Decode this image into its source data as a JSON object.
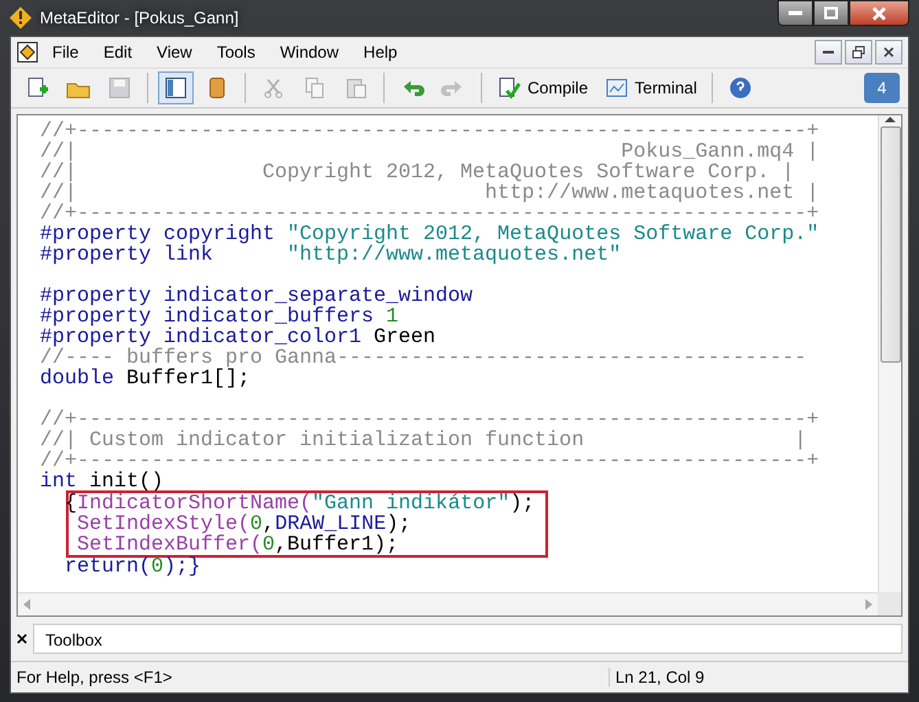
{
  "window": {
    "title": "MetaEditor - [Pokus_Gann]"
  },
  "menu": [
    {
      "label": "File"
    },
    {
      "label": "Edit"
    },
    {
      "label": "View"
    },
    {
      "label": "Tools"
    },
    {
      "label": "Window"
    },
    {
      "label": "Help"
    }
  ],
  "toolbar": [
    {
      "kind": "new"
    },
    {
      "kind": "open"
    },
    {
      "kind": "save",
      "disabled": true
    },
    {
      "kind": "sep"
    },
    {
      "kind": "navigator",
      "selected": true
    },
    {
      "kind": "book"
    },
    {
      "kind": "sep"
    },
    {
      "kind": "cut",
      "disabled": true
    },
    {
      "kind": "copy",
      "disabled": true
    },
    {
      "kind": "paste",
      "disabled": true
    },
    {
      "kind": "sep"
    },
    {
      "kind": "undo"
    },
    {
      "kind": "redo",
      "disabled": true
    },
    {
      "kind": "sep"
    },
    {
      "kind": "compile",
      "label": "Compile"
    },
    {
      "kind": "terminal",
      "label": "Terminal"
    },
    {
      "kind": "sep"
    },
    {
      "kind": "help"
    }
  ],
  "chat_badge": "4",
  "editor": {
    "lines": [
      {
        "kind": "code",
        "tokens": [
          {
            "kind": "comment",
            "text": "//+-----------------------------------------------------------+"
          }
        ]
      },
      {
        "kind": "code",
        "tokens": [
          {
            "kind": "comment",
            "text": "//|                                            Pokus_Gann.mq4 |"
          }
        ]
      },
      {
        "kind": "code",
        "tokens": [
          {
            "kind": "comment",
            "text": "//|               Copyright 2012, MetaQuotes Software Corp. |"
          }
        ]
      },
      {
        "kind": "code",
        "tokens": [
          {
            "kind": "comment",
            "text": "//|                                 http://www.metaquotes.net |"
          }
        ]
      },
      {
        "kind": "code",
        "tokens": [
          {
            "kind": "comment",
            "text": "//+-----------------------------------------------------------+"
          }
        ]
      },
      {
        "kind": "code",
        "tokens": [
          {
            "kind": "keyword",
            "text": "#property copyright "
          },
          {
            "kind": "string",
            "text": "\"Copyright 2012, MetaQuotes Software Corp.\""
          }
        ]
      },
      {
        "kind": "code",
        "tokens": [
          {
            "kind": "keyword",
            "text": "#property link      "
          },
          {
            "kind": "string",
            "text": "\"http://www.metaquotes.net\""
          }
        ]
      },
      {
        "kind": "blank"
      },
      {
        "kind": "code",
        "tokens": [
          {
            "kind": "keyword",
            "text": "#property indicator_separate_window"
          }
        ]
      },
      {
        "kind": "code",
        "tokens": [
          {
            "kind": "keyword",
            "text": "#property indicator_buffers "
          },
          {
            "kind": "number",
            "text": "1"
          }
        ]
      },
      {
        "kind": "code",
        "tokens": [
          {
            "kind": "keyword",
            "text": "#property indicator_color1 "
          },
          {
            "kind": "plain",
            "text": "Green"
          }
        ]
      },
      {
        "kind": "code",
        "tokens": [
          {
            "kind": "comment",
            "text": "//---- buffers pro Ganna--------------------------------------"
          }
        ]
      },
      {
        "kind": "code",
        "tokens": [
          {
            "kind": "keyword",
            "text": "double "
          },
          {
            "kind": "plain",
            "text": "Buffer1[];"
          }
        ]
      },
      {
        "kind": "blank"
      },
      {
        "kind": "code",
        "tokens": [
          {
            "kind": "comment",
            "text": "//+-----------------------------------------------------------+"
          }
        ]
      },
      {
        "kind": "code",
        "tokens": [
          {
            "kind": "comment",
            "text": "//| Custom indicator initialization function                 |"
          }
        ]
      },
      {
        "kind": "code",
        "tokens": [
          {
            "kind": "comment",
            "text": "//+-----------------------------------------------------------+"
          }
        ]
      },
      {
        "kind": "code",
        "tokens": [
          {
            "kind": "keyword",
            "text": "int "
          },
          {
            "kind": "plain",
            "text": "init()"
          }
        ]
      },
      {
        "kind": "code",
        "boxed": true,
        "tokens": [
          {
            "kind": "plain",
            "text": "  {"
          },
          {
            "kind": "function",
            "text": "IndicatorShortName("
          },
          {
            "kind": "string",
            "text": "\"Gann indikátor\""
          },
          {
            "kind": "plain",
            "text": ");"
          }
        ]
      },
      {
        "kind": "code",
        "boxed": true,
        "tokens": [
          {
            "kind": "function",
            "text": "   SetIndexStyle("
          },
          {
            "kind": "number",
            "text": "0"
          },
          {
            "kind": "plain",
            "text": ","
          },
          {
            "kind": "keyword",
            "text": "DRAW_LINE"
          },
          {
            "kind": "plain",
            "text": ");"
          }
        ]
      },
      {
        "kind": "code",
        "boxed": true,
        "tokens": [
          {
            "kind": "function",
            "text": "   SetIndexBuffer("
          },
          {
            "kind": "number",
            "text": "0"
          },
          {
            "kind": "plain",
            "text": ",Buffer1);"
          }
        ]
      },
      {
        "kind": "code",
        "tokens": [
          {
            "kind": "keyword",
            "text": "  return("
          },
          {
            "kind": "number",
            "text": "0"
          },
          {
            "kind": "keyword",
            "text": ");}"
          }
        ]
      }
    ]
  },
  "toolbox": {
    "title": "Toolbox"
  },
  "status_bar": {
    "help": "For Help, press <F1>",
    "position": "Ln 21, Col 9"
  }
}
